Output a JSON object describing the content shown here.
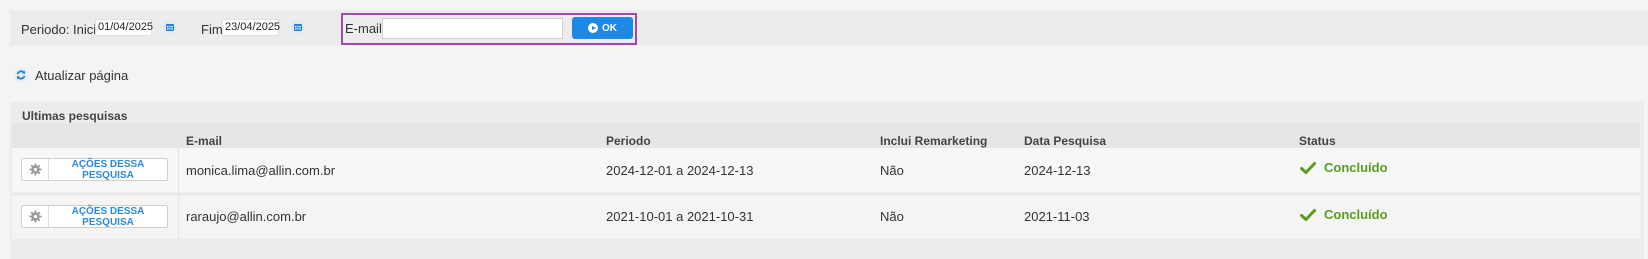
{
  "filters": {
    "start_label": "Periodo: Inicio",
    "start_value": "01/04/2025",
    "end_label": "Fim",
    "end_value": "23/04/2025",
    "email_label": "E-mail",
    "email_value": "",
    "ok_label": "OK"
  },
  "refresh_label": "Atualizar página",
  "panel": {
    "title": "Ultimas pesquisas",
    "columns": [
      "E-mail",
      "Periodo",
      "Inclui Remarketing",
      "Data Pesquisa",
      "Status"
    ],
    "rows": [
      {
        "action_label": "AÇÕES DESSA PESQUISA",
        "email": "monica.lima@allin.com.br",
        "periodo": "2024-12-01 a 2024-12-13",
        "remarketing": "Não",
        "data": "2024-12-13",
        "status": "Concluído"
      },
      {
        "action_label": "AÇÕES DESSA PESQUISA",
        "email": "raraujo@allin.com.br",
        "periodo": "2021-10-01 a 2021-10-31",
        "remarketing": "Não",
        "data": "2021-11-03",
        "status": "Concluído"
      }
    ]
  },
  "colors": {
    "accent": "#1e88e5",
    "highlight_border": "#a04ab0",
    "status_ok": "#5a9c1f"
  }
}
